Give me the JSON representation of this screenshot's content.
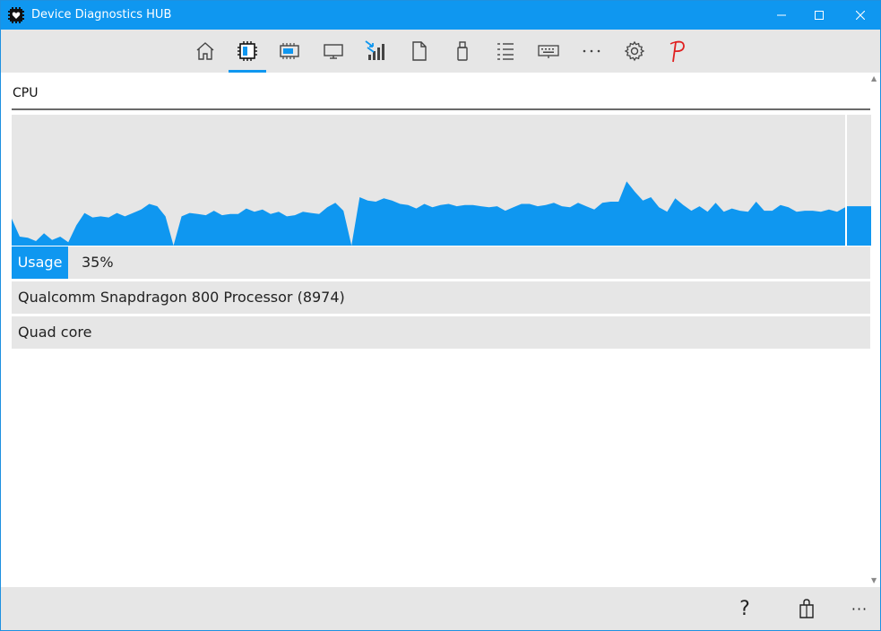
{
  "window": {
    "title": "Device Diagnostics HUB"
  },
  "nav": {
    "items": [
      {
        "icon": "home-icon"
      },
      {
        "icon": "cpu-icon",
        "selected": true
      },
      {
        "icon": "memory-icon"
      },
      {
        "icon": "display-icon"
      },
      {
        "icon": "network-icon"
      },
      {
        "icon": "document-icon"
      },
      {
        "icon": "usb-drive-icon"
      },
      {
        "icon": "list-icon"
      },
      {
        "icon": "keyboard-icon"
      },
      {
        "icon": "more-icon"
      },
      {
        "icon": "gear-icon"
      },
      {
        "icon": "p-logo-icon"
      }
    ]
  },
  "cpu": {
    "section_title": "CPU",
    "usage_label": "Usage",
    "usage_value": "35%",
    "processor": "Qualcomm Snapdragon 800 Processor (8974)",
    "cores": "Quad core"
  },
  "chart_data": {
    "type": "area",
    "ylim": [
      0,
      100
    ],
    "current": 35,
    "values": [
      24,
      8,
      7,
      4,
      11,
      5,
      8,
      3,
      18,
      29,
      25,
      26,
      25,
      29,
      26,
      29,
      32,
      37,
      35,
      26,
      0,
      26,
      29,
      28,
      27,
      31,
      27,
      28,
      28,
      33,
      30,
      32,
      28,
      30,
      26,
      27,
      30,
      29,
      28,
      34,
      38,
      31,
      0,
      43,
      40,
      39,
      42,
      40,
      37,
      36,
      33,
      37,
      34,
      36,
      37,
      35,
      36,
      36,
      35,
      34,
      35,
      31,
      34,
      37,
      37,
      35,
      36,
      38,
      35,
      34,
      38,
      35,
      32,
      38,
      39,
      39,
      57,
      48,
      40,
      43,
      34,
      30,
      42,
      36,
      31,
      35,
      30,
      38,
      30,
      33,
      31,
      30,
      39,
      31,
      31,
      36,
      34,
      30,
      31,
      31,
      30,
      32,
      30,
      34
    ]
  },
  "bottom": {
    "help_label": "?",
    "more_label": "···"
  },
  "colors": {
    "accent": "#0f97f0",
    "panel": "#e6e6e6"
  }
}
